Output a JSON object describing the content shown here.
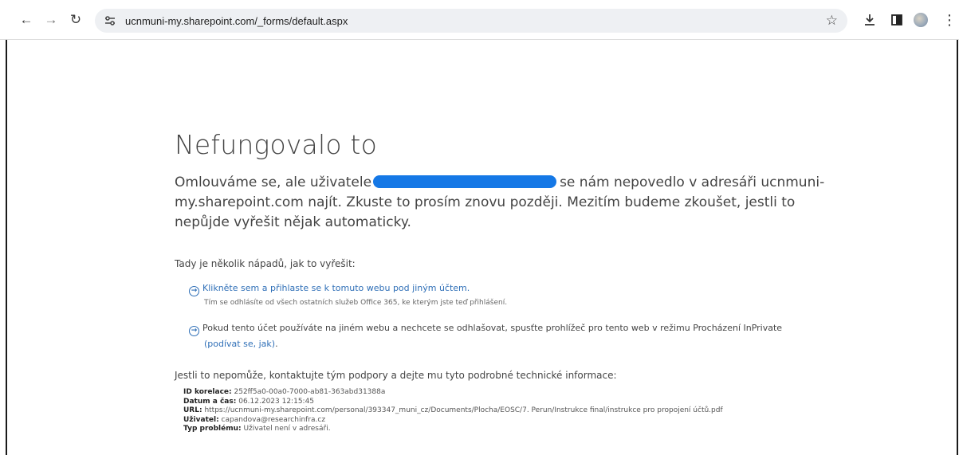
{
  "browser": {
    "url": "ucnmuni-my.sharepoint.com/_forms/default.aspx",
    "icons": [
      "back-icon",
      "forward-icon",
      "reload-icon",
      "site-info-icon",
      "bookmark-star-icon",
      "download-icon",
      "side-panel-icon",
      "profile-avatar",
      "menu-icon"
    ]
  },
  "error": {
    "title": "Nefungovalo to",
    "message_before": "Omlouváme se, ale uživatele",
    "message_after": "se nám nepovedlo v adresáři ucnmuni-my.sharepoint.com najít. Zkuste to prosím znovu později. Mezitím budeme zkoušet, jestli to nepůjde vyřešit nějak automaticky."
  },
  "ideas": {
    "heading": "Tady je několik nápadů, jak to vyřešit:",
    "item1_link": "Klikněte sem a přihlaste se k tomuto webu pod jiným účtem.",
    "item1_sub": "Tím se odhlásíte od všech ostatních služeb Office 365, ke kterým jste teď přihlášení.",
    "item2_text": "Pokud tento účet používáte na jiném webu a nechcete se odhlašovat, spusťte prohlížeč pro tento web v režimu Procházení InPrivate",
    "item2_link": "(podívat se, jak)",
    "item2_period": "."
  },
  "support": {
    "heading": "Jestli to nepomůže, kontaktujte tým podpory a dejte mu tyto podrobné technické informace:",
    "details": [
      {
        "label": "ID korelace:",
        "value": "252ff5a0-00a0-7000-ab81-363abd31388a"
      },
      {
        "label": "Datum a čas:",
        "value": "06.12.2023 12:15:45"
      },
      {
        "label": "URL:",
        "value": "https://ucnmuni-my.sharepoint.com/personal/393347_muni_cz/Documents/Plocha/EOSC/7. Perun/Instrukce final/instrukce pro propojení účtů.pdf"
      },
      {
        "label": "Uživatel:",
        "value": "capandova@researchinfra.cz"
      },
      {
        "label": "Typ problému:",
        "value": "Uživatel není v adresáři."
      }
    ]
  }
}
